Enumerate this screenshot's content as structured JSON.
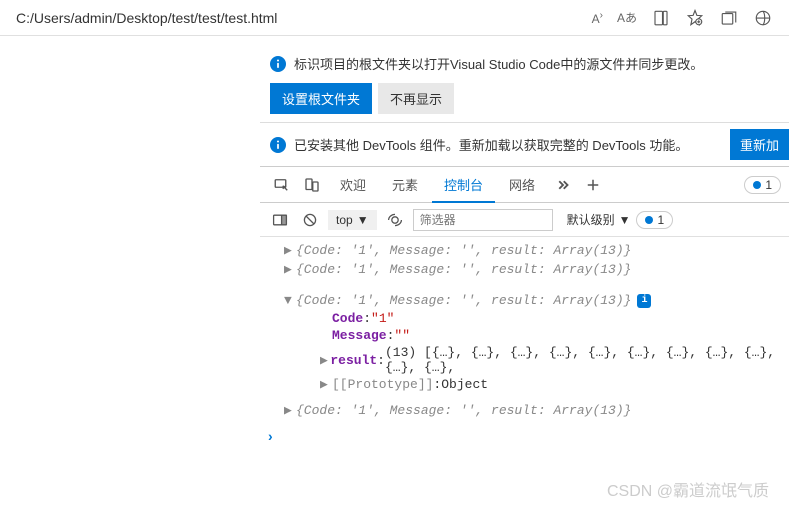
{
  "address_bar": {
    "url": "C:/Users/admin/Desktop/test/test/test.html",
    "read_aloud": "Aあ"
  },
  "banner1": {
    "text": "标识项目的根文件夹以打开Visual Studio Code中的源文件并同步更改。",
    "btn_primary": "设置根文件夹",
    "btn_secondary": "不再显示"
  },
  "banner2": {
    "text": "已安装其他 DevTools 组件。重新加载以获取完整的 DevTools 功能。",
    "btn_action": "重新加"
  },
  "tabs": {
    "welcome": "欢迎",
    "elements": "元素",
    "console": "控制台",
    "network": "网络"
  },
  "msg_count": "1",
  "toolbar": {
    "context": "top",
    "filter_placeholder": "筛选器",
    "level": "默认级别",
    "msg_badge": "1"
  },
  "console_logs": {
    "collapsed_summary": "{Code: '1', Message: '', result: Array(13)}",
    "expanded": {
      "summary": "{Code: '1', Message: '', result: Array(13)}",
      "props": {
        "code_key": "Code",
        "code_val": "\"1\"",
        "message_key": "Message",
        "message_val": "\"\"",
        "result_key": "result",
        "result_count": "(13)",
        "result_preview": "[{…}, {…}, {…}, {…}, {…}, {…}, {…}, {…}, {…}, {…}, {…},",
        "proto_key": "[[Prototype]]",
        "proto_val": "Object"
      }
    }
  },
  "watermark": "CSDN @霸道流氓气质"
}
